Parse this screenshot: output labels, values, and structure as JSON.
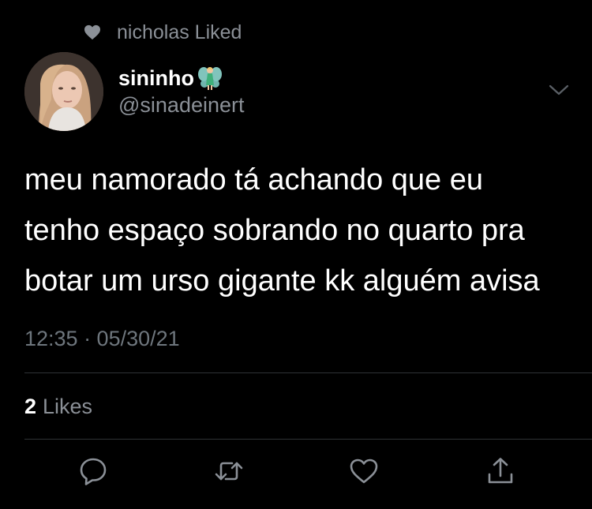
{
  "social_context": {
    "icon": "heart-icon",
    "text": "nicholas Liked"
  },
  "author": {
    "display_name": "sininho",
    "emoji": "fairy",
    "handle": "@sinadeinert",
    "avatar": "profile-photo"
  },
  "tweet": {
    "lines": [
      "meu namorado tá achando que eu",
      "tenho espaço sobrando no quarto pra",
      "botar um urso gigante kk alguém avisa"
    ],
    "timestamp": "12:35 · 05/30/21"
  },
  "stats": {
    "likes_count": "2",
    "likes_label": "Likes"
  },
  "actions": [
    {
      "icon": "reply-icon"
    },
    {
      "icon": "retweet-icon"
    },
    {
      "icon": "like-icon"
    },
    {
      "icon": "share-icon"
    }
  ],
  "colors": {
    "background": "#000000",
    "text": "#ffffff",
    "secondary": "#8b9097",
    "divider": "#2f3336"
  }
}
